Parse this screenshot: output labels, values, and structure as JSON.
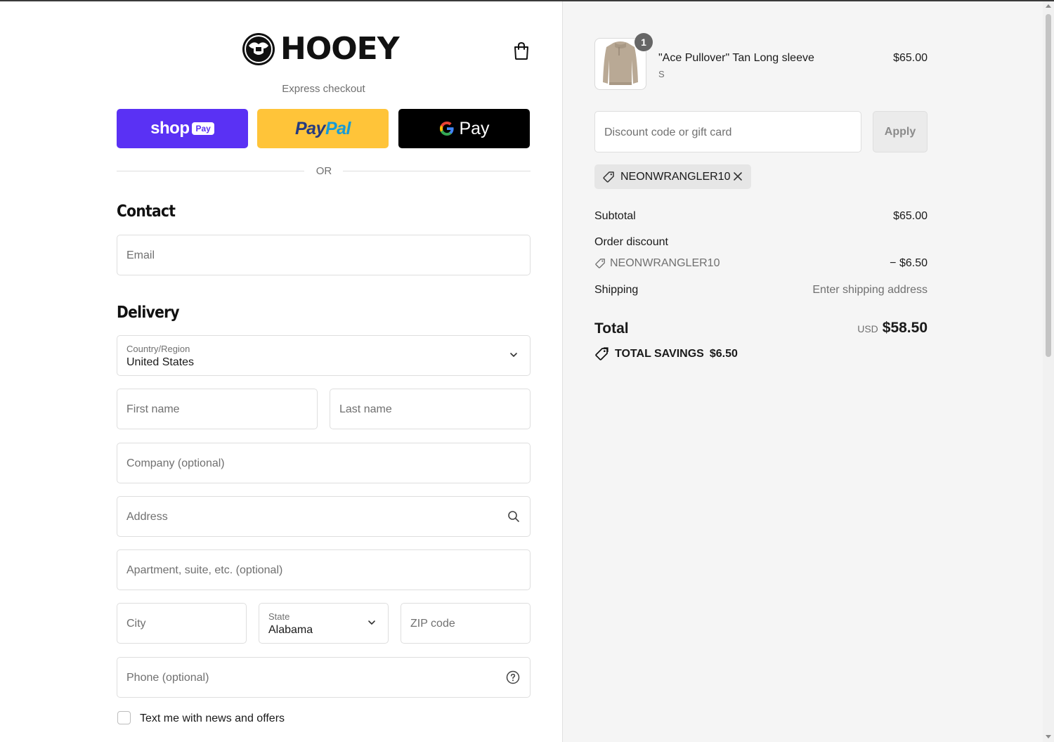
{
  "brand": {
    "name": "HOOEY"
  },
  "express": {
    "label": "Express checkout",
    "buttons": [
      {
        "name": "shop",
        "badge": "Pay",
        "color": "#5a31f4"
      },
      {
        "name_part1": "Pay",
        "name_part2": "Pal",
        "color": "#ffc439"
      },
      {
        "g": "G",
        "name": "Pay",
        "color": "#000000"
      }
    ],
    "or": "OR"
  },
  "contact": {
    "title": "Contact",
    "email_placeholder": "Email"
  },
  "delivery": {
    "title": "Delivery",
    "country_label": "Country/Region",
    "country_value": "United States",
    "first_name": "First name",
    "last_name": "Last name",
    "company": "Company (optional)",
    "address": "Address",
    "apartment": "Apartment, suite, etc. (optional)",
    "city": "City",
    "state_label": "State",
    "state_value": "Alabama",
    "zip": "ZIP code",
    "phone": "Phone (optional)",
    "sms_optin": "Text me with news and offers"
  },
  "summary": {
    "item": {
      "quantity": "1",
      "name": "\"Ace Pullover\" Tan Long sleeve",
      "variant": "S",
      "price": "$65.00"
    },
    "discount_placeholder": "Discount code or gift card",
    "apply_label": "Apply",
    "applied_code": "NEONWRANGLER10",
    "subtotal_label": "Subtotal",
    "subtotal_value": "$65.00",
    "order_discount_label": "Order discount",
    "order_discount_code": "NEONWRANGLER10",
    "order_discount_value": "− $6.50",
    "shipping_label": "Shipping",
    "shipping_value": "Enter shipping address",
    "total_label": "Total",
    "total_currency": "USD",
    "total_value": "$58.50",
    "savings_label": "TOTAL SAVINGS",
    "savings_value": "$6.50"
  },
  "colors": {
    "accent_shop": "#5a31f4",
    "paypal_yellow": "#ffc439",
    "summary_bg": "#f5f5f5"
  }
}
